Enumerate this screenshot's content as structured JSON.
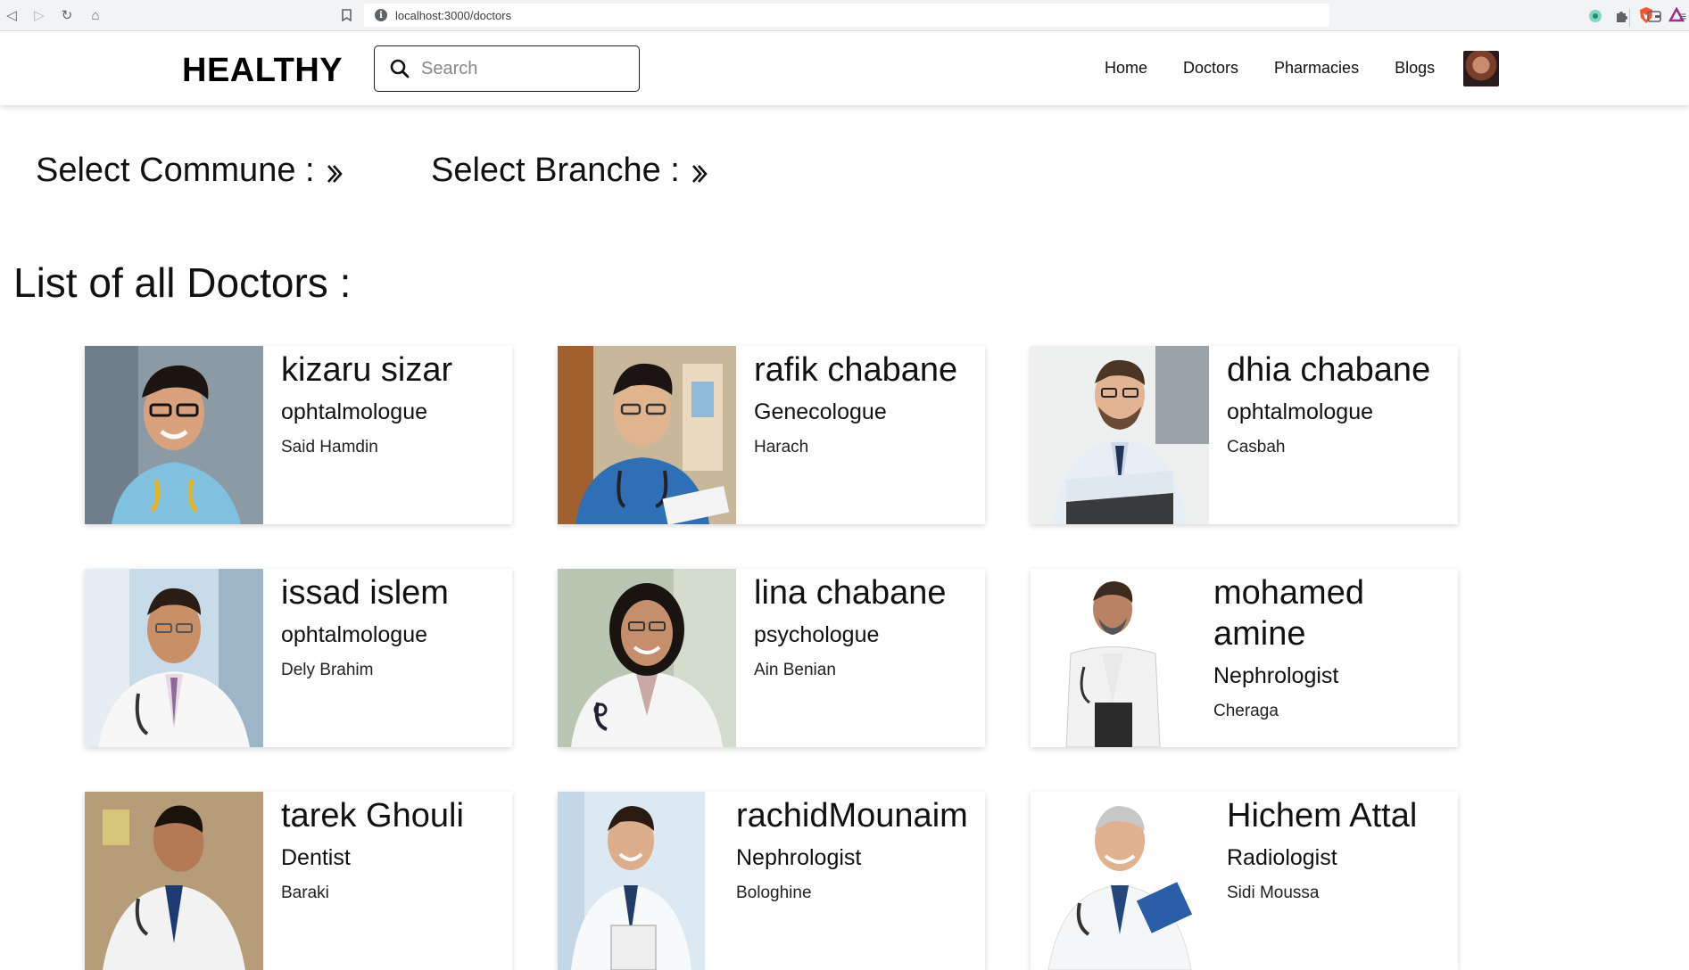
{
  "browser": {
    "url": "localhost:3000/doctors"
  },
  "header": {
    "logo": "HEALTHY",
    "search_placeholder": "Search",
    "nav": [
      "Home",
      "Doctors",
      "Pharmacies",
      "Blogs"
    ]
  },
  "filters": {
    "commune_label": "Select Commune :",
    "branche_label": "Select Branche :"
  },
  "list_title": "List of all Doctors :",
  "doctors": [
    {
      "name": "kizaru sizar",
      "branch": "ophtalmologue",
      "commune": "Said Hamdin"
    },
    {
      "name": "rafik chabane",
      "branch": "Genecologue",
      "commune": "Harach"
    },
    {
      "name": "dhia chabane",
      "branch": "ophtalmologue",
      "commune": "Casbah"
    },
    {
      "name": "issad islem",
      "branch": "ophtalmologue",
      "commune": "Dely Brahim"
    },
    {
      "name": "lina chabane",
      "branch": "psychologue",
      "commune": "Ain Benian"
    },
    {
      "name": "mohamed amine",
      "branch": "Nephrologist",
      "commune": "Cheraga"
    },
    {
      "name": "tarek Ghouli",
      "branch": "Dentist",
      "commune": "Baraki"
    },
    {
      "name": "rachidMounaim",
      "branch": "Nephrologist",
      "commune": "Bologhine"
    },
    {
      "name": "Hichem Attal",
      "branch": "Radiologist",
      "commune": "Sidi Moussa"
    }
  ],
  "colors": {
    "accent": "#000000",
    "card_shadow": "rgba(0,0,0,0.16)"
  }
}
